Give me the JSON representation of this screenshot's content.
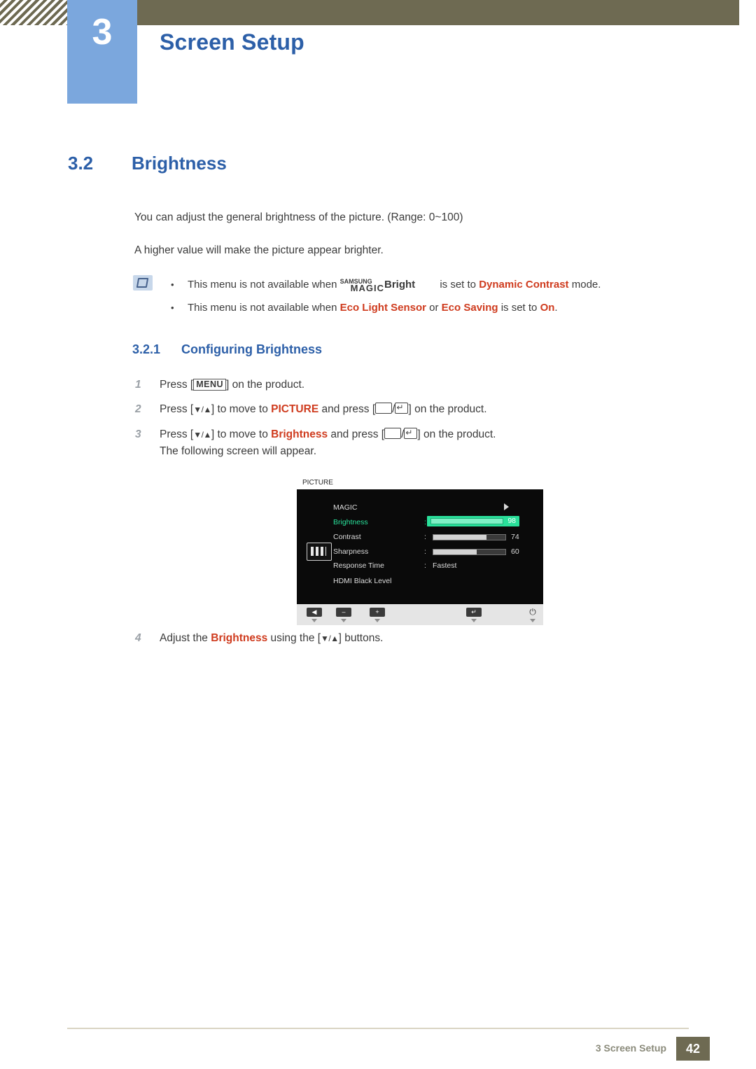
{
  "header": {
    "chapter_number": "3",
    "chapter_title": "Screen Setup"
  },
  "section": {
    "number": "3.2",
    "title": "Brightness"
  },
  "body": {
    "para1": "You can adjust the general brightness of the picture. (Range: 0~100)",
    "para2": "A higher value will make the picture appear brighter."
  },
  "notes": {
    "note1": {
      "prefix": "This menu is not available when ",
      "magic_samsung": "SAMSUNG",
      "magic_magic": "MAGIC",
      "magic_bright": "Bright",
      "middle": " is set to ",
      "highlight": "Dynamic Contrast",
      "suffix": " mode."
    },
    "note2": {
      "prefix": "This menu is not available when ",
      "term1": "Eco Light Sensor",
      "conj": " or ",
      "term2": "Eco Saving",
      "middle": " is set to ",
      "highlight": "On",
      "suffix": "."
    }
  },
  "subsection": {
    "number": "3.2.1",
    "title": "Configuring Brightness"
  },
  "steps": [
    {
      "num": "1",
      "parts": [
        "Press [",
        "MENU",
        "] on the product."
      ]
    },
    {
      "num": "2",
      "parts": [
        "Press [",
        "▼/▲",
        "] to move to ",
        "PICTURE",
        " and press [",
        "/",
        "] on the product."
      ]
    },
    {
      "num": "3",
      "parts": [
        "Press [",
        "▼/▲",
        "] to move to ",
        "Brightness",
        " and press [",
        "/",
        "] on the product."
      ],
      "line2": "The following screen will appear."
    },
    {
      "num": "4",
      "parts": [
        "Adjust the ",
        "Brightness",
        " using the [",
        "▼/▲",
        "] buttons."
      ]
    }
  ],
  "osd": {
    "title": "PICTURE",
    "rows": [
      {
        "label": "MAGIC",
        "value": "",
        "type": "arrow"
      },
      {
        "label": "Brightness",
        "value": "98",
        "type": "slider-selected",
        "fill_pct": 100
      },
      {
        "label": "Contrast",
        "value": "74",
        "type": "slider",
        "fill_pct": 74
      },
      {
        "label": "Sharpness",
        "value": "60",
        "type": "slider",
        "fill_pct": 60
      },
      {
        "label": "Response Time",
        "value": "Fastest",
        "type": "text"
      },
      {
        "label": "HDMI Black Level",
        "value": "",
        "type": "plain"
      }
    ],
    "buttons": [
      {
        "name": "back-button",
        "glyph": "◀"
      },
      {
        "name": "minus-button",
        "glyph": "–"
      },
      {
        "name": "plus-button",
        "glyph": "+"
      },
      {
        "name": "enter-button",
        "glyph": "↵"
      },
      {
        "name": "power-button",
        "glyph": "⏻"
      }
    ]
  },
  "footer": {
    "text": "3 Screen Setup",
    "page": "42"
  }
}
